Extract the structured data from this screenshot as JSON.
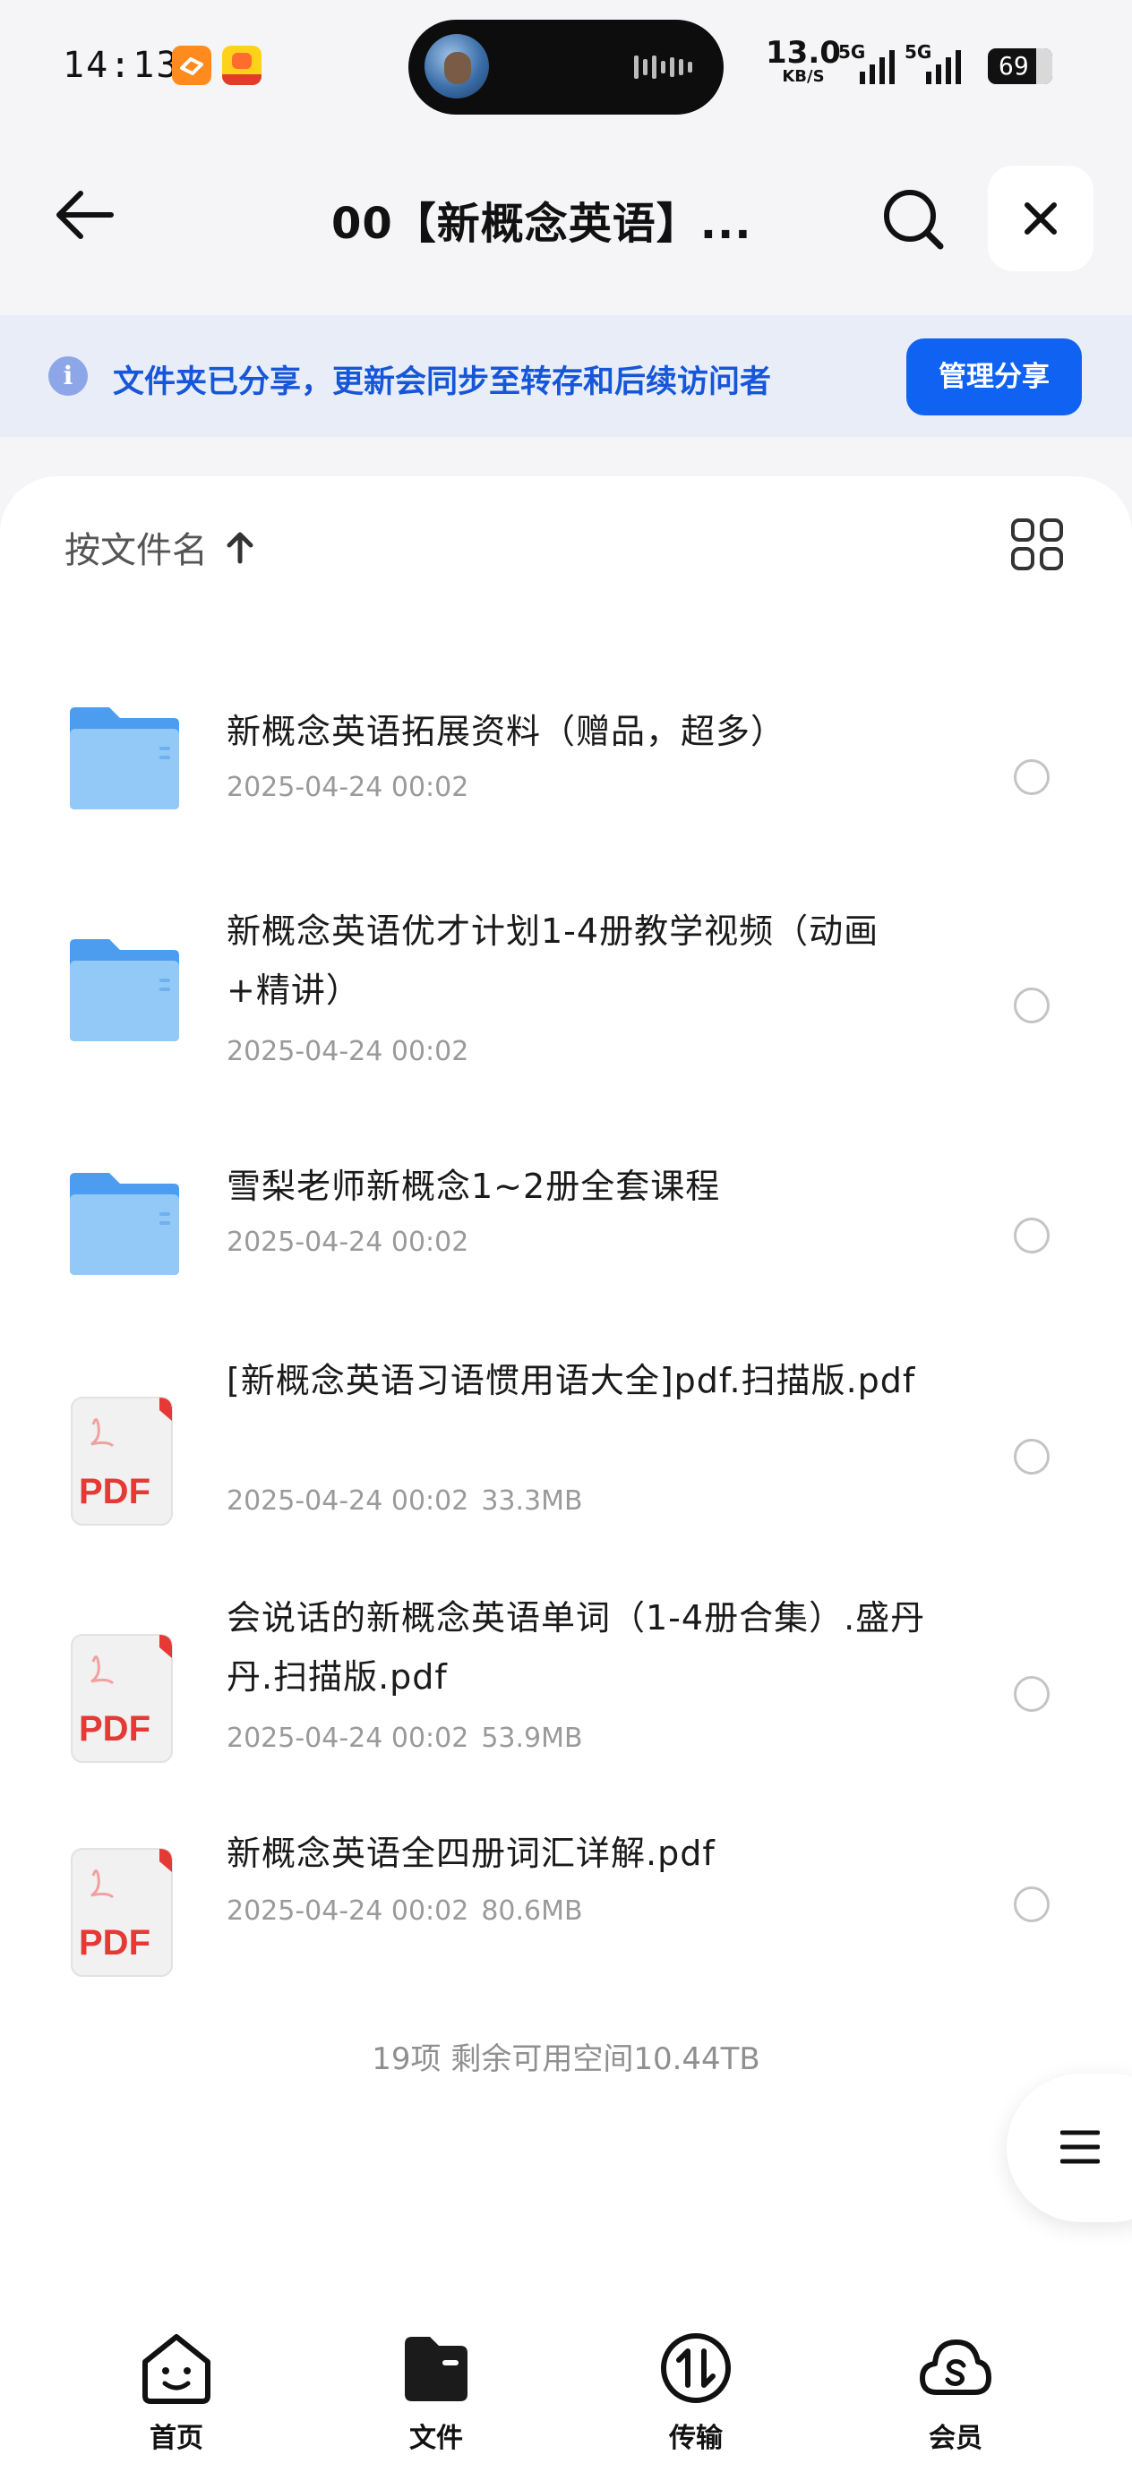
{
  "status_bar": {
    "time": "14:13",
    "net_speed": "13.0",
    "net_speed_unit": "KB/S",
    "signal1_label": "5G",
    "signal2_label": "5G",
    "battery": "69"
  },
  "header": {
    "title": "00【新概念英语】..."
  },
  "banner": {
    "message": "文件夹已分享，更新会同步至转存和后续访问者",
    "button": "管理分享"
  },
  "sort": {
    "label": "按文件名"
  },
  "files": [
    {
      "type": "folder",
      "name": "新概念英语拓展资料（赠品，超多）",
      "date": "2025-04-24 00:02",
      "size": ""
    },
    {
      "type": "folder",
      "name": "新概念英语优才计划1-4册教学视频（动画+精讲）",
      "date": "2025-04-24 00:02",
      "size": ""
    },
    {
      "type": "folder",
      "name": "雪梨老师新概念1~2册全套课程",
      "date": "2025-04-24 00:02",
      "size": ""
    },
    {
      "type": "pdf",
      "name": "[新概念英语习语惯用语大全]pdf.扫描版.pdf",
      "date": "2025-04-24 00:02",
      "size": "33.3MB"
    },
    {
      "type": "pdf",
      "name": "会说话的新概念英语单词（1-4册合集）.盛丹丹.扫描版.pdf",
      "date": "2025-04-24 00:02",
      "size": "53.9MB"
    },
    {
      "type": "pdf",
      "name": "新概念英语全四册词汇详解.pdf",
      "date": "2025-04-24 00:02",
      "size": "80.6MB"
    }
  ],
  "pdf_badge": "PDF",
  "summary": "19项 剩余可用空间10.44TB",
  "nav": [
    {
      "label": "首页",
      "icon": "home-face-icon"
    },
    {
      "label": "文件",
      "icon": "folder-icon"
    },
    {
      "label": "传输",
      "icon": "transfer-icon"
    },
    {
      "label": "会员",
      "icon": "cloud-vip-icon"
    }
  ],
  "colors": {
    "accent": "#1063f2",
    "banner_bg": "#e9edf8",
    "banner_text": "#1656d8",
    "folder": "#8ec5f5",
    "pdf": "#e53935"
  }
}
